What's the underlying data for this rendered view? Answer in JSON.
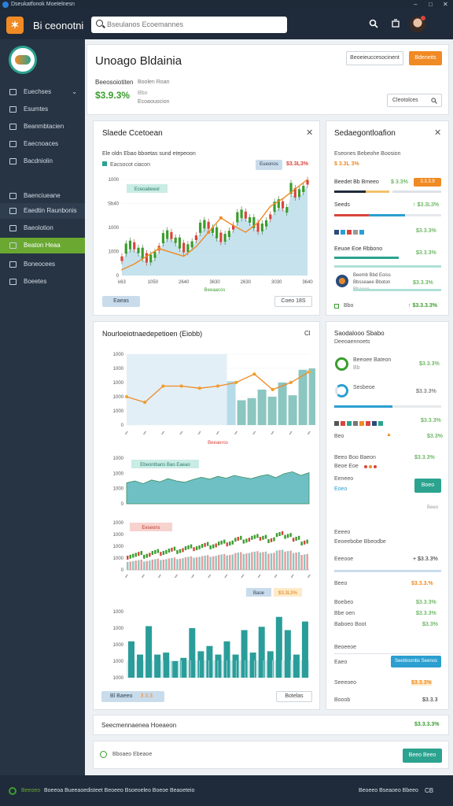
{
  "window": {
    "title": "Dseukatfonok Moetelnesn",
    "controls": [
      "–",
      "□",
      "✕"
    ]
  },
  "topbar": {
    "logo_glyph": "✶",
    "app_name": "Bi ceonotni",
    "search_placeholder": "Bseulanos Ecoemannes",
    "icons": [
      "search-icon",
      "share-icon",
      "user-avatar"
    ]
  },
  "sidebar": {
    "items": [
      {
        "label": "Euechses",
        "icon": "folder-icon"
      },
      {
        "label": "Esumtes",
        "icon": "grid-icon"
      },
      {
        "label": "Beanmbtacien",
        "icon": "bars-icon"
      },
      {
        "label": "Eaecnoaces",
        "icon": "chart-icon"
      },
      {
        "label": "Bacdniolin",
        "icon": "clock-icon"
      },
      {
        "label": "Baenciueane",
        "icon": "cloud-icon"
      },
      {
        "label": "Eaedtin Raunbonis",
        "icon": "list-icon"
      },
      {
        "label": "Baeolotion",
        "icon": "leaf-icon"
      },
      {
        "label": "Beaton Heaa",
        "icon": "monitor-icon"
      },
      {
        "label": "Boneocees",
        "icon": "settings-icon"
      },
      {
        "label": "Boeetes",
        "icon": "box-icon"
      }
    ],
    "active_index": 8,
    "colors": {
      "bg": "#263443",
      "active": "#6aa832"
    }
  },
  "header": {
    "title": "Unoago Bldainia",
    "sub_label": "Beeosoiotiten",
    "sub_label2": "Boolen Roan",
    "value": "$3.9.3%",
    "value_note1": "Bbo",
    "value_note2": "Ecoaouocion",
    "btn_outline": "Beoeieuccesocinent",
    "btn_orange": "Bdeneits",
    "select_value": "Cleotolces"
  },
  "candle_card": {
    "title": "Slaede Ccetoean",
    "subtitle": "Ele oldn Ebao bboetas sund etepeoon",
    "legend": "Eacsocot ciacon",
    "badge": "Eueonos",
    "value": "$3.3L3%",
    "tag": "Eceoabeeor",
    "y_ticks": [
      "1000",
      "Sb40",
      "1000",
      "1000",
      "0"
    ],
    "x_ticks": [
      "k63",
      "1050",
      "2640",
      "3630",
      "2630",
      "3030",
      "3640"
    ],
    "x_caption": "Beeaacos",
    "btn_left": "Eaeas",
    "btn_right": "Coeo 18S"
  },
  "summary_card": {
    "title": "Sedaegontloafion",
    "line1": "Eseones Bebeohe Boosion",
    "line1_val": "$ 3.3L 3%",
    "tag_orange": "3.3.3.9",
    "row1_label": "Beedet Bb Bmeeo",
    "row1_val1": "$ 3.3%",
    "row1_val2": "3.43.3.3",
    "row2_label": "Seeds",
    "row2_val": "↑ $3.3L3%",
    "row3_val": "$3.3.3%",
    "row4_label": "Eeuoe Eoe Rbbono",
    "row4_val": "$3.3.3%",
    "row5_label1": "Beemb Bbd Eoiss",
    "row5_label2": "Bbsseaee Bboton",
    "row5_label3": "Bbaeoo",
    "row5_val": "$3.3.3%",
    "row6_label": "Bbo",
    "row6_val": "↑ $3.3.3.3%"
  },
  "multi_card": {
    "title": "Nourloeiotnaedepetioen (Eiobb)",
    "icon_label": "Cl",
    "c1_y": [
      "1000",
      "1000",
      "1000",
      "1000",
      "1000",
      "0"
    ],
    "c1_caption": "Beeaeros",
    "c2_label": "Ebeontbans Bao Eaeao",
    "c2_y": [
      "1000",
      "1000",
      "1000",
      "0"
    ],
    "c3_label": "Eeseons",
    "c3_y": [
      "1000",
      "1000",
      "1000",
      "1000",
      "0"
    ],
    "c3_tag": "Baoe",
    "c3_tag_val": "$3.3L3%",
    "c4_y": [
      "1000",
      "1000",
      "1000",
      "1000",
      "1000"
    ],
    "btn_left": "Bl Baeeo",
    "btn_left_val": "3 3.3",
    "btn_right": "Botelas",
    "c2_values": [
      46,
      50,
      44,
      52,
      48,
      55,
      50,
      47,
      53,
      58,
      54,
      60,
      56,
      62,
      58,
      55,
      60,
      64,
      57,
      66,
      70,
      62,
      68
    ],
    "c3_values": [
      20,
      26,
      22,
      30,
      28,
      35,
      32,
      40,
      38,
      45,
      42,
      50,
      48,
      58,
      54,
      62,
      60,
      55,
      68,
      64,
      58,
      50
    ],
    "c4_values": [
      55,
      35,
      78,
      35,
      38,
      25,
      30,
      75,
      40,
      48,
      35,
      55,
      35,
      72,
      38,
      77,
      40,
      92,
      72,
      35,
      85
    ],
    "c1_line": [
      40,
      32,
      55,
      55,
      52,
      55,
      60,
      72,
      50,
      60,
      75
    ],
    "c1_bars": [
      62,
      35,
      38,
      50,
      40,
      60,
      42,
      78,
      80
    ]
  },
  "right2_card": {
    "title": "Saodalooo Sbabo",
    "subtitle": "Deeoaennoets",
    "ring1_label": "Beeoee Bateon",
    "ring1_sub": "Bb",
    "ring1_val": "$3.3.3%",
    "ring2_label": "Sesbeoe",
    "ring2_val": "$3.3.3%",
    "val_row": "$3.3.3%",
    "chip_row_label": "Beo",
    "chip_row_val": "$3.3%",
    "r1_label": "Beeo Boo Baeon",
    "r1_val": "$3.3.3%",
    "r1_sub": "Beoe Eoe",
    "r2_label": "Eeneeo",
    "r2_sub": "Eoeo",
    "r2_btn": "Boeo",
    "r2_right": "Beeo",
    "r3_label": "Eeeeo",
    "r3_sub": "Eeoeebobe Bbeodbe",
    "r4_label": "Eeeooe",
    "r4_val": "+ $3.3.3%",
    "r5_label": "Beeo",
    "r5_val": "$3.3.3.%",
    "r6_label": "Boebeo",
    "r6_val": "$3.3.3%",
    "r7_label": "Bbe oen",
    "r7_val": "$3.3.3%",
    "r8_label": "Baboeo Boot",
    "r8_val": "$3.3%",
    "r9_label": "Beoeeoe",
    "r10_label": "Eaeo",
    "r10_btn": "Seebtoonbs Seenos",
    "r11_label": "Seeeoeo",
    "r11_val": "$3.3.3%",
    "r12_label": "Booob",
    "r12_val": "$3.3.3"
  },
  "strip1": {
    "label": "Seecmennaenea Hoeaeon",
    "val": "$3.3.3.3%"
  },
  "strip2": {
    "label": "Bboaeo Ebeaoe",
    "btn": "Beeo Beeo"
  },
  "footer": {
    "status": "Beeoeo",
    "text": "Boeeoa Bueeaoedisteet Beoeeo Bsoeoeleo Boeoe Beaoeteio",
    "right": "Beoeeo Bseaoeo Bbeeo",
    "right2": "CB"
  }
}
